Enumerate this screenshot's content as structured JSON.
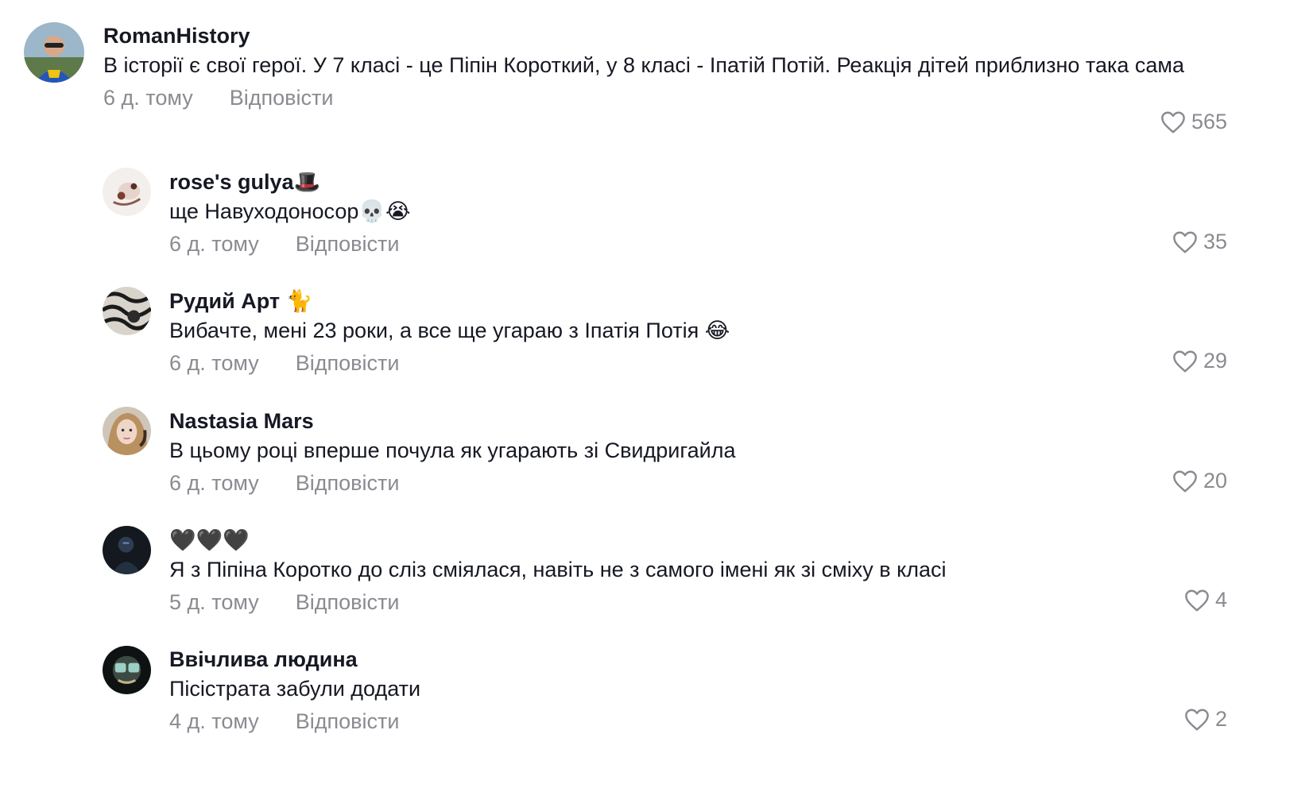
{
  "comments": [
    {
      "username": "RomanHistory",
      "text": "В історії є свої герої. У 7 класі - це Піпін Короткий, у 8 класі - Іпатій Потій. Реакція дітей приблизно така сама",
      "time": "6 д. тому",
      "reply_label": "Відповісти",
      "likes": "565"
    },
    {
      "username": "rose's gulya🎩",
      "text": "ще Навуходоносор💀😭",
      "time": "6 д. тому",
      "reply_label": "Відповісти",
      "likes": "35"
    },
    {
      "username": "Рудий Арт 🐈",
      "text": "Вибачте, мені 23 роки, а все ще угараю з Іпатія Потія 😂",
      "time": "6 д. тому",
      "reply_label": "Відповісти",
      "likes": "29"
    },
    {
      "username": "Nastasia Mars",
      "text": "В цьому році вперше почула як угарають зі Свидригайла",
      "time": "6 д. тому",
      "reply_label": "Відповісти",
      "likes": "20"
    },
    {
      "username": "🖤🖤🖤",
      "text": "Я з Піпіна Коротко до сліз сміялася, навіть не з самого імені як зі сміху в класі",
      "time": "5 д. тому",
      "reply_label": "Відповісти",
      "likes": "4"
    },
    {
      "username": "Ввічлива людина",
      "text": "Пісістрата забули додати",
      "time": "4 д. тому",
      "reply_label": "Відповісти",
      "likes": "2"
    }
  ],
  "icons": {
    "like": "heart-outline-icon"
  },
  "colors": {
    "text_primary": "#161823",
    "text_secondary": "#8a8b91",
    "background": "#ffffff"
  }
}
